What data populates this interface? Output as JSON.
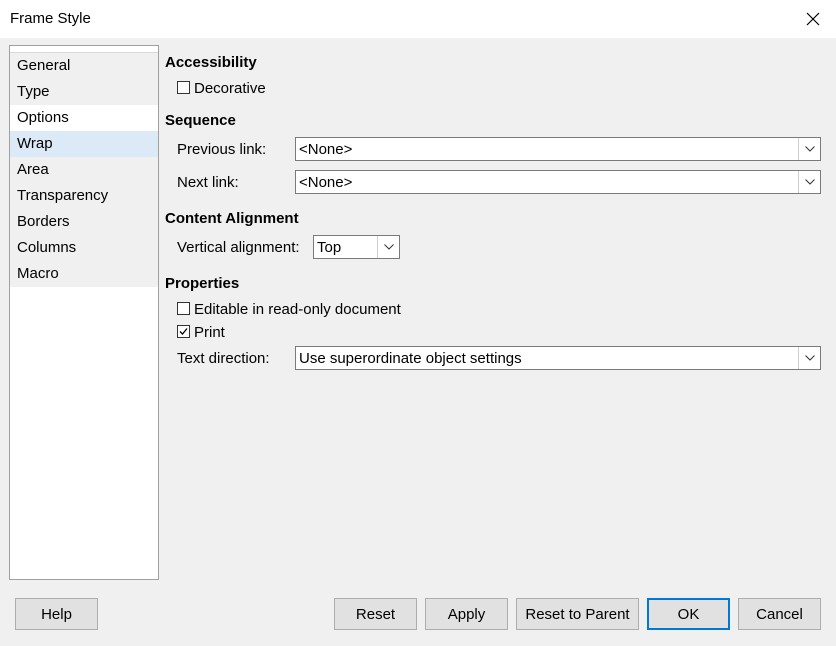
{
  "window": {
    "title": "Frame Style"
  },
  "sidebar": {
    "items": [
      {
        "label": "General"
      },
      {
        "label": "Type"
      },
      {
        "label": "Options"
      },
      {
        "label": "Wrap"
      },
      {
        "label": "Area"
      },
      {
        "label": "Transparency"
      },
      {
        "label": "Borders"
      },
      {
        "label": "Columns"
      },
      {
        "label": "Macro"
      }
    ]
  },
  "accessibility": {
    "heading": "Accessibility",
    "decorative_label": "Decorative",
    "decorative_checked": false
  },
  "sequence": {
    "heading": "Sequence",
    "previous_label": "Previous link:",
    "previous_value": "<None>",
    "next_label": "Next link:",
    "next_value": "<None>"
  },
  "alignment": {
    "heading": "Content Alignment",
    "vertical_label": "Vertical alignment:",
    "vertical_value": "Top"
  },
  "properties": {
    "heading": "Properties",
    "editable_label": "Editable in read-only document",
    "editable_checked": false,
    "print_label": "Print",
    "print_checked": true,
    "textdir_label": "Text direction:",
    "textdir_value": "Use superordinate object settings"
  },
  "buttons": {
    "help": "Help",
    "reset": "Reset",
    "apply": "Apply",
    "reset_parent": "Reset to Parent",
    "ok": "OK",
    "cancel": "Cancel"
  }
}
